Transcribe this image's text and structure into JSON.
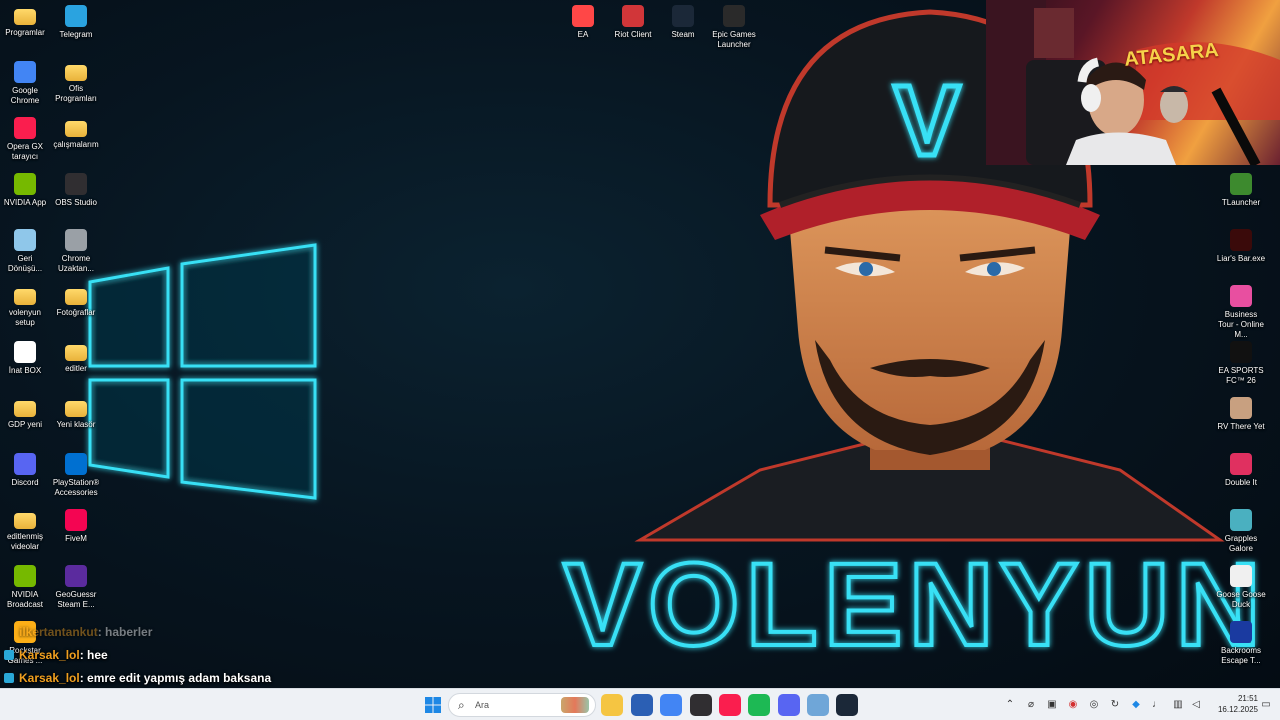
{
  "desktop": {
    "left_icons": [
      {
        "label": "Programlar",
        "icon": "folder-icon",
        "color": "#f5c542"
      },
      {
        "label": "Telegram",
        "icon": "telegram-icon",
        "color": "#2aa3e0"
      },
      {
        "label": "Google Chrome",
        "icon": "chrome-icon",
        "color": "#4285f4"
      },
      {
        "label": "Ofis Programları",
        "icon": "folder-icon",
        "color": "#f5c542"
      },
      {
        "label": "Opera GX tarayıcı",
        "icon": "opera-gx-icon",
        "color": "#fa1e4e"
      },
      {
        "label": "çalışmalarım",
        "icon": "folder-icon",
        "color": "#f5c542"
      },
      {
        "label": "NVIDIA App",
        "icon": "nvidia-icon",
        "color": "#76b900"
      },
      {
        "label": "OBS Studio",
        "icon": "obs-icon",
        "color": "#302e31"
      },
      {
        "label": "Geri Dönüşü...",
        "icon": "recycle-bin-icon",
        "color": "#8fc7ea"
      },
      {
        "label": "Chrome Uzaktan...",
        "icon": "chrome-remote-icon",
        "color": "#9aa0a6"
      },
      {
        "label": "volenyun setup",
        "icon": "folder-icon",
        "color": "#f5c542"
      },
      {
        "label": "Fotoğraflar",
        "icon": "folder-icon",
        "color": "#f5c542"
      },
      {
        "label": "İnat BOX",
        "icon": "inat-box-icon",
        "color": "#ffffff"
      },
      {
        "label": "editler",
        "icon": "folder-icon",
        "color": "#f5c542"
      },
      {
        "label": "GDP yeni",
        "icon": "folder-icon",
        "color": "#f5c542"
      },
      {
        "label": "Yeni klasör",
        "icon": "folder-icon",
        "color": "#f5c542"
      },
      {
        "label": "Discord",
        "icon": "discord-icon",
        "color": "#5865f2"
      },
      {
        "label": "PlayStation® Accessories",
        "icon": "playstation-icon",
        "color": "#0070d1"
      },
      {
        "label": "editlenmiş videolar",
        "icon": "folder-icon",
        "color": "#f5c542"
      },
      {
        "label": "FiveM",
        "icon": "fivem-icon",
        "color": "#f40552"
      },
      {
        "label": "NVIDIA Broadcast",
        "icon": "nvidia-broadcast-icon",
        "color": "#76b900"
      },
      {
        "label": "GeoGuessr Steam E...",
        "icon": "geoguessr-icon",
        "color": "#5b2b9e"
      },
      {
        "label": "Rockstar Games ...",
        "icon": "rockstar-icon",
        "color": "#fcaf17"
      }
    ],
    "top_icons": [
      {
        "label": "EA",
        "icon": "ea-icon",
        "color": "#ff4747"
      },
      {
        "label": "Riot Client",
        "icon": "riot-icon",
        "color": "#d13639"
      },
      {
        "label": "Steam",
        "icon": "steam-icon",
        "color": "#1b2838"
      },
      {
        "label": "Epic Games Launcher",
        "icon": "epic-games-icon",
        "color": "#2a2a2a"
      }
    ],
    "right_icons": [
      {
        "label": "TLauncher",
        "icon": "tlauncher-icon",
        "color": "#3d8a2e"
      },
      {
        "label": "Liar's Bar.exe",
        "icon": "liars-bar-icon",
        "color": "#3a0a0a"
      },
      {
        "label": "Business Tour - Online M...",
        "icon": "business-tour-icon",
        "color": "#e84fa0"
      },
      {
        "label": "EA SPORTS FC™ 26",
        "icon": "ea-fc-icon",
        "color": "#111111"
      },
      {
        "label": "RV There Yet",
        "icon": "rv-there-yet-icon",
        "color": "#c8a080"
      },
      {
        "label": "Double It",
        "icon": "double-it-icon",
        "color": "#e03060"
      },
      {
        "label": "Grapples Galore",
        "icon": "grapples-galore-icon",
        "color": "#4ab0c0"
      },
      {
        "label": "Goose Goose Duck",
        "icon": "goose-goose-duck-icon",
        "color": "#f0f0f0"
      },
      {
        "label": "Backrooms Escape T...",
        "icon": "backrooms-icon",
        "color": "#1a3aa0"
      }
    ]
  },
  "wallpaper": {
    "brand_text": "VOLENYUN",
    "cap_letter": "V",
    "neon_color": "#22d3ee"
  },
  "chat": [
    {
      "user": "ilkertantankut",
      "message": ": haberler"
    },
    {
      "user": "Karsak_lol",
      "message": ": hee"
    },
    {
      "user": "Karsak_lol",
      "message": ": emre edit yapmış adam baksana"
    }
  ],
  "webcam": {
    "banner_text": "ATASARA"
  },
  "taskbar": {
    "search_placeholder": "Ara",
    "apps": [
      {
        "name": "file-explorer-icon",
        "color": "#f5c542"
      },
      {
        "name": "microsoft-store-icon",
        "color": "#2b5fb4"
      },
      {
        "name": "chrome-icon",
        "color": "#4285f4"
      },
      {
        "name": "obs-icon",
        "color": "#302e31"
      },
      {
        "name": "opera-gx-icon",
        "color": "#fa1e4e"
      },
      {
        "name": "spotify-icon",
        "color": "#1db954"
      },
      {
        "name": "discord-icon",
        "color": "#5865f2"
      },
      {
        "name": "settings-icon",
        "color": "#6fa6d8"
      },
      {
        "name": "steam-icon",
        "color": "#1b2838"
      }
    ],
    "clock_time": "21:51",
    "clock_date": "16.12.2025"
  }
}
